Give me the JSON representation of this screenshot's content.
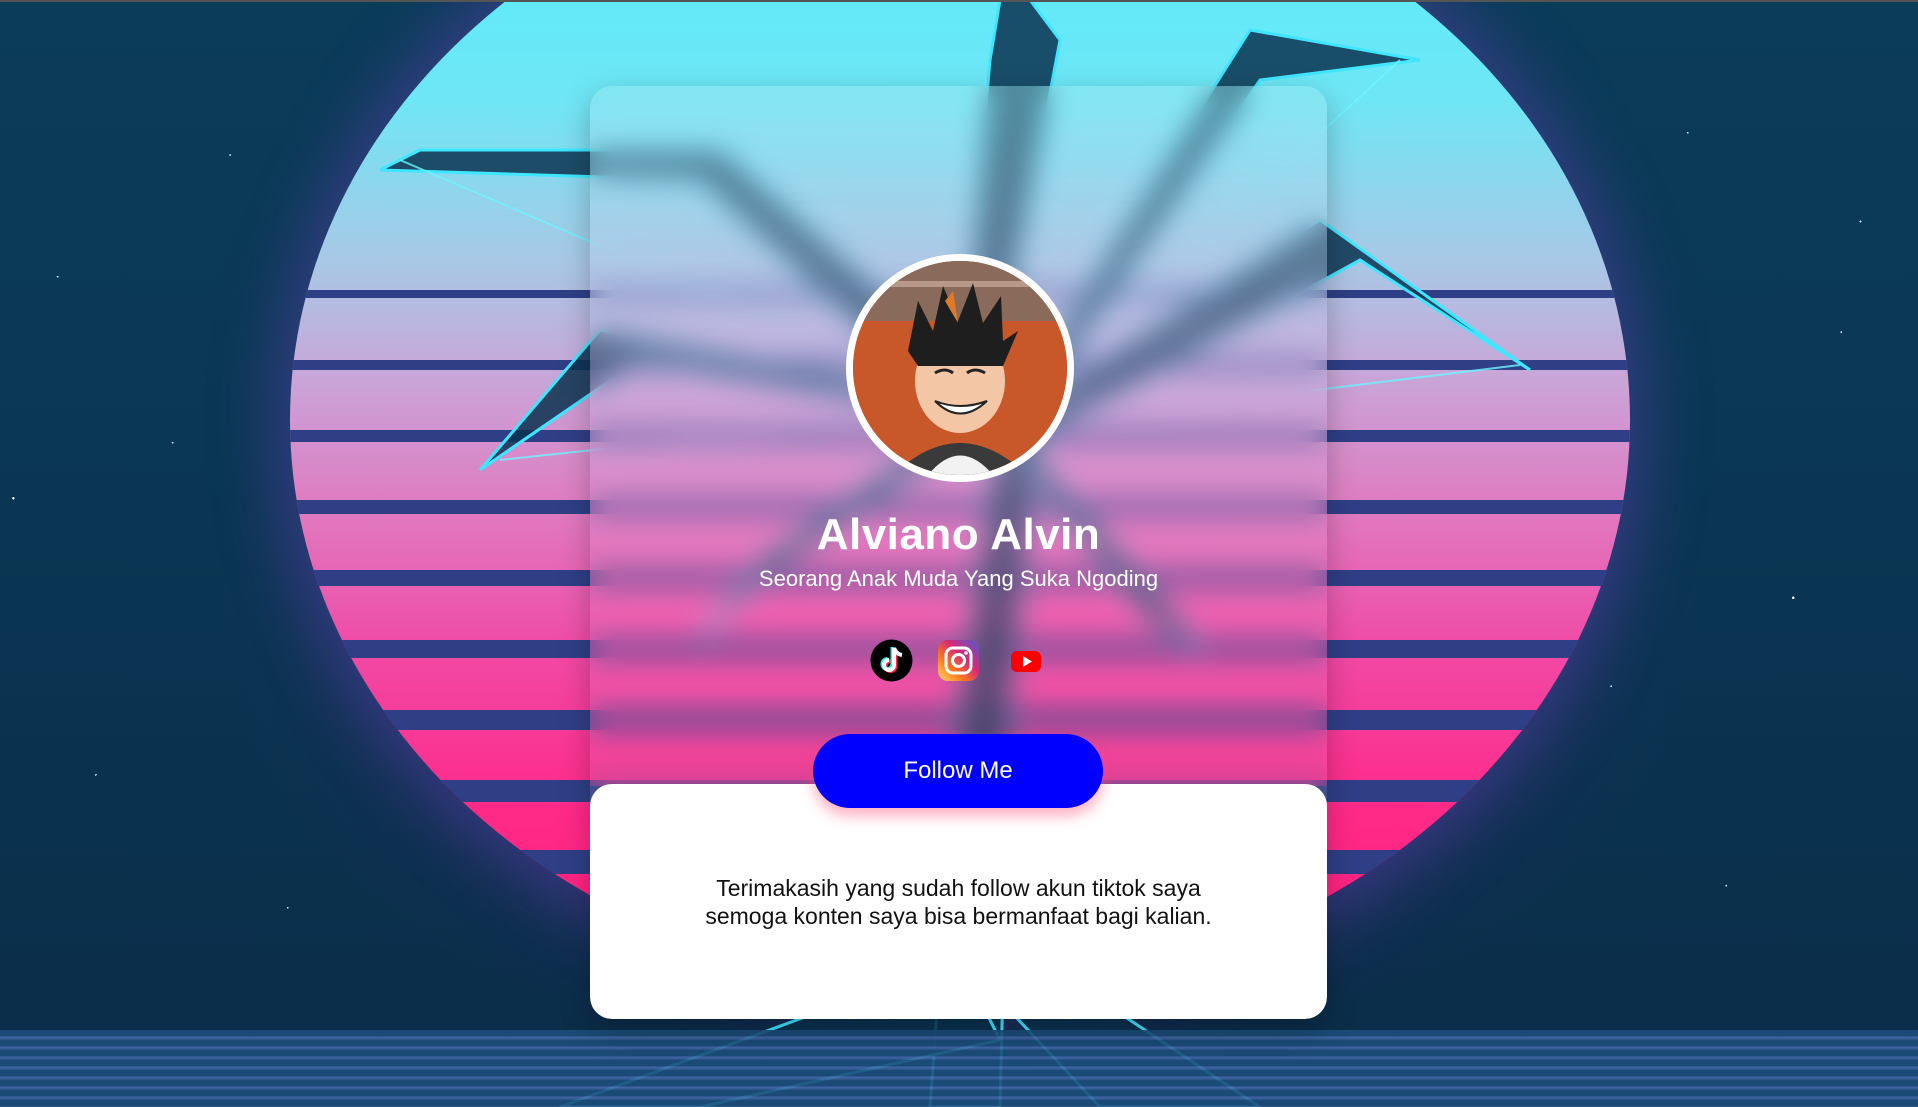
{
  "profile": {
    "name": "Alviano Alvin",
    "tagline": "Seorang Anak Muda Yang Suka Ngoding",
    "avatar": "anime-character-avatar"
  },
  "socials": [
    {
      "name": "tiktok-icon",
      "color": "#000000"
    },
    {
      "name": "instagram-icon",
      "color": "#d62976"
    },
    {
      "name": "youtube-icon",
      "color": "#ff0000"
    }
  ],
  "follow_button": {
    "label": "Follow Me",
    "color": "#0000ff"
  },
  "message": {
    "line1": "Terimakasih yang sudah follow akun tiktok saya",
    "line2": "semoga konten saya bisa bermanfaat bagi kalian."
  },
  "colors": {
    "background": "#0a3550",
    "sun_top": "#4ff0ff",
    "sun_bottom": "#ff1d7a",
    "stripe": "#2f3f86"
  }
}
